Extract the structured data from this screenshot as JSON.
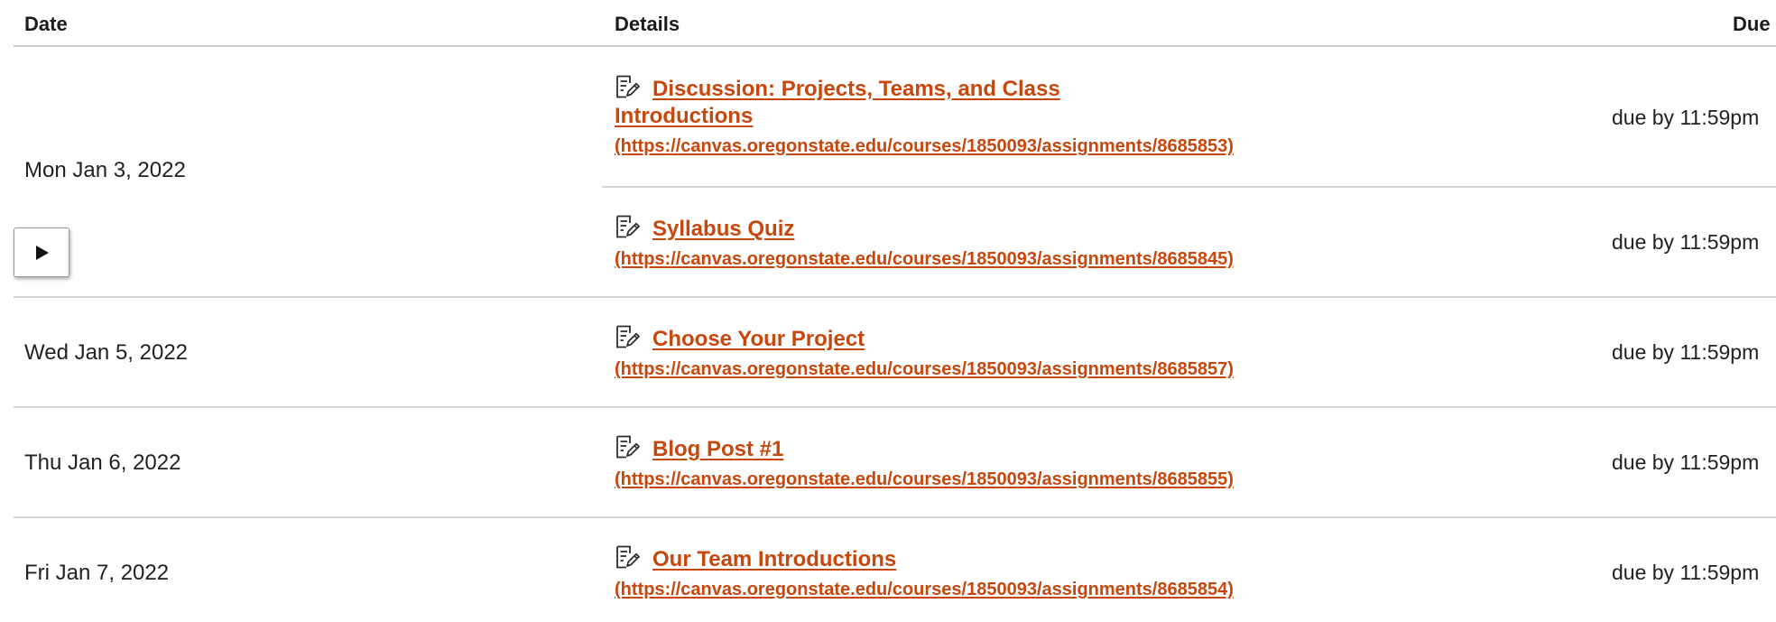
{
  "table": {
    "headers": {
      "date": "Date",
      "details": "Details",
      "due": "Due"
    },
    "rows": [
      {
        "date": "Mon Jan 3, 2022",
        "items": [
          {
            "title_line1": "Discussion: Projects, Teams, and Class",
            "title_line2": "Introductions",
            "url": "(https://canvas.oregonstate.edu/courses/1850093/assignments/8685853)",
            "due": "due by 11:59pm",
            "icon": "assignment-icon"
          },
          {
            "title": "Syllabus Quiz",
            "url": "(https://canvas.oregonstate.edu/courses/1850093/assignments/8685845)",
            "due": "due by 11:59pm",
            "icon": "assignment-icon"
          }
        ]
      },
      {
        "date": "Wed Jan 5, 2022",
        "items": [
          {
            "title": "Choose Your Project",
            "url": "(https://canvas.oregonstate.edu/courses/1850093/assignments/8685857)",
            "due": "due by 11:59pm",
            "icon": "assignment-icon"
          }
        ]
      },
      {
        "date": "Thu Jan 6, 2022",
        "items": [
          {
            "title": "Blog Post #1",
            "url": "(https://canvas.oregonstate.edu/courses/1850093/assignments/8685855)",
            "due": "due by 11:59pm",
            "icon": "assignment-icon"
          }
        ]
      },
      {
        "date": "Fri Jan 7, 2022",
        "items": [
          {
            "title": "Our Team Introductions",
            "url": "(https://canvas.oregonstate.edu/courses/1850093/assignments/8685854)",
            "due": "due by 11:59pm",
            "icon": "assignment-icon"
          }
        ]
      }
    ]
  },
  "controls": {
    "play_icon": "play-icon"
  },
  "colors": {
    "link": "#c8470d",
    "divider": "#cfd4d8",
    "header_rule": "#c7cdd1"
  }
}
